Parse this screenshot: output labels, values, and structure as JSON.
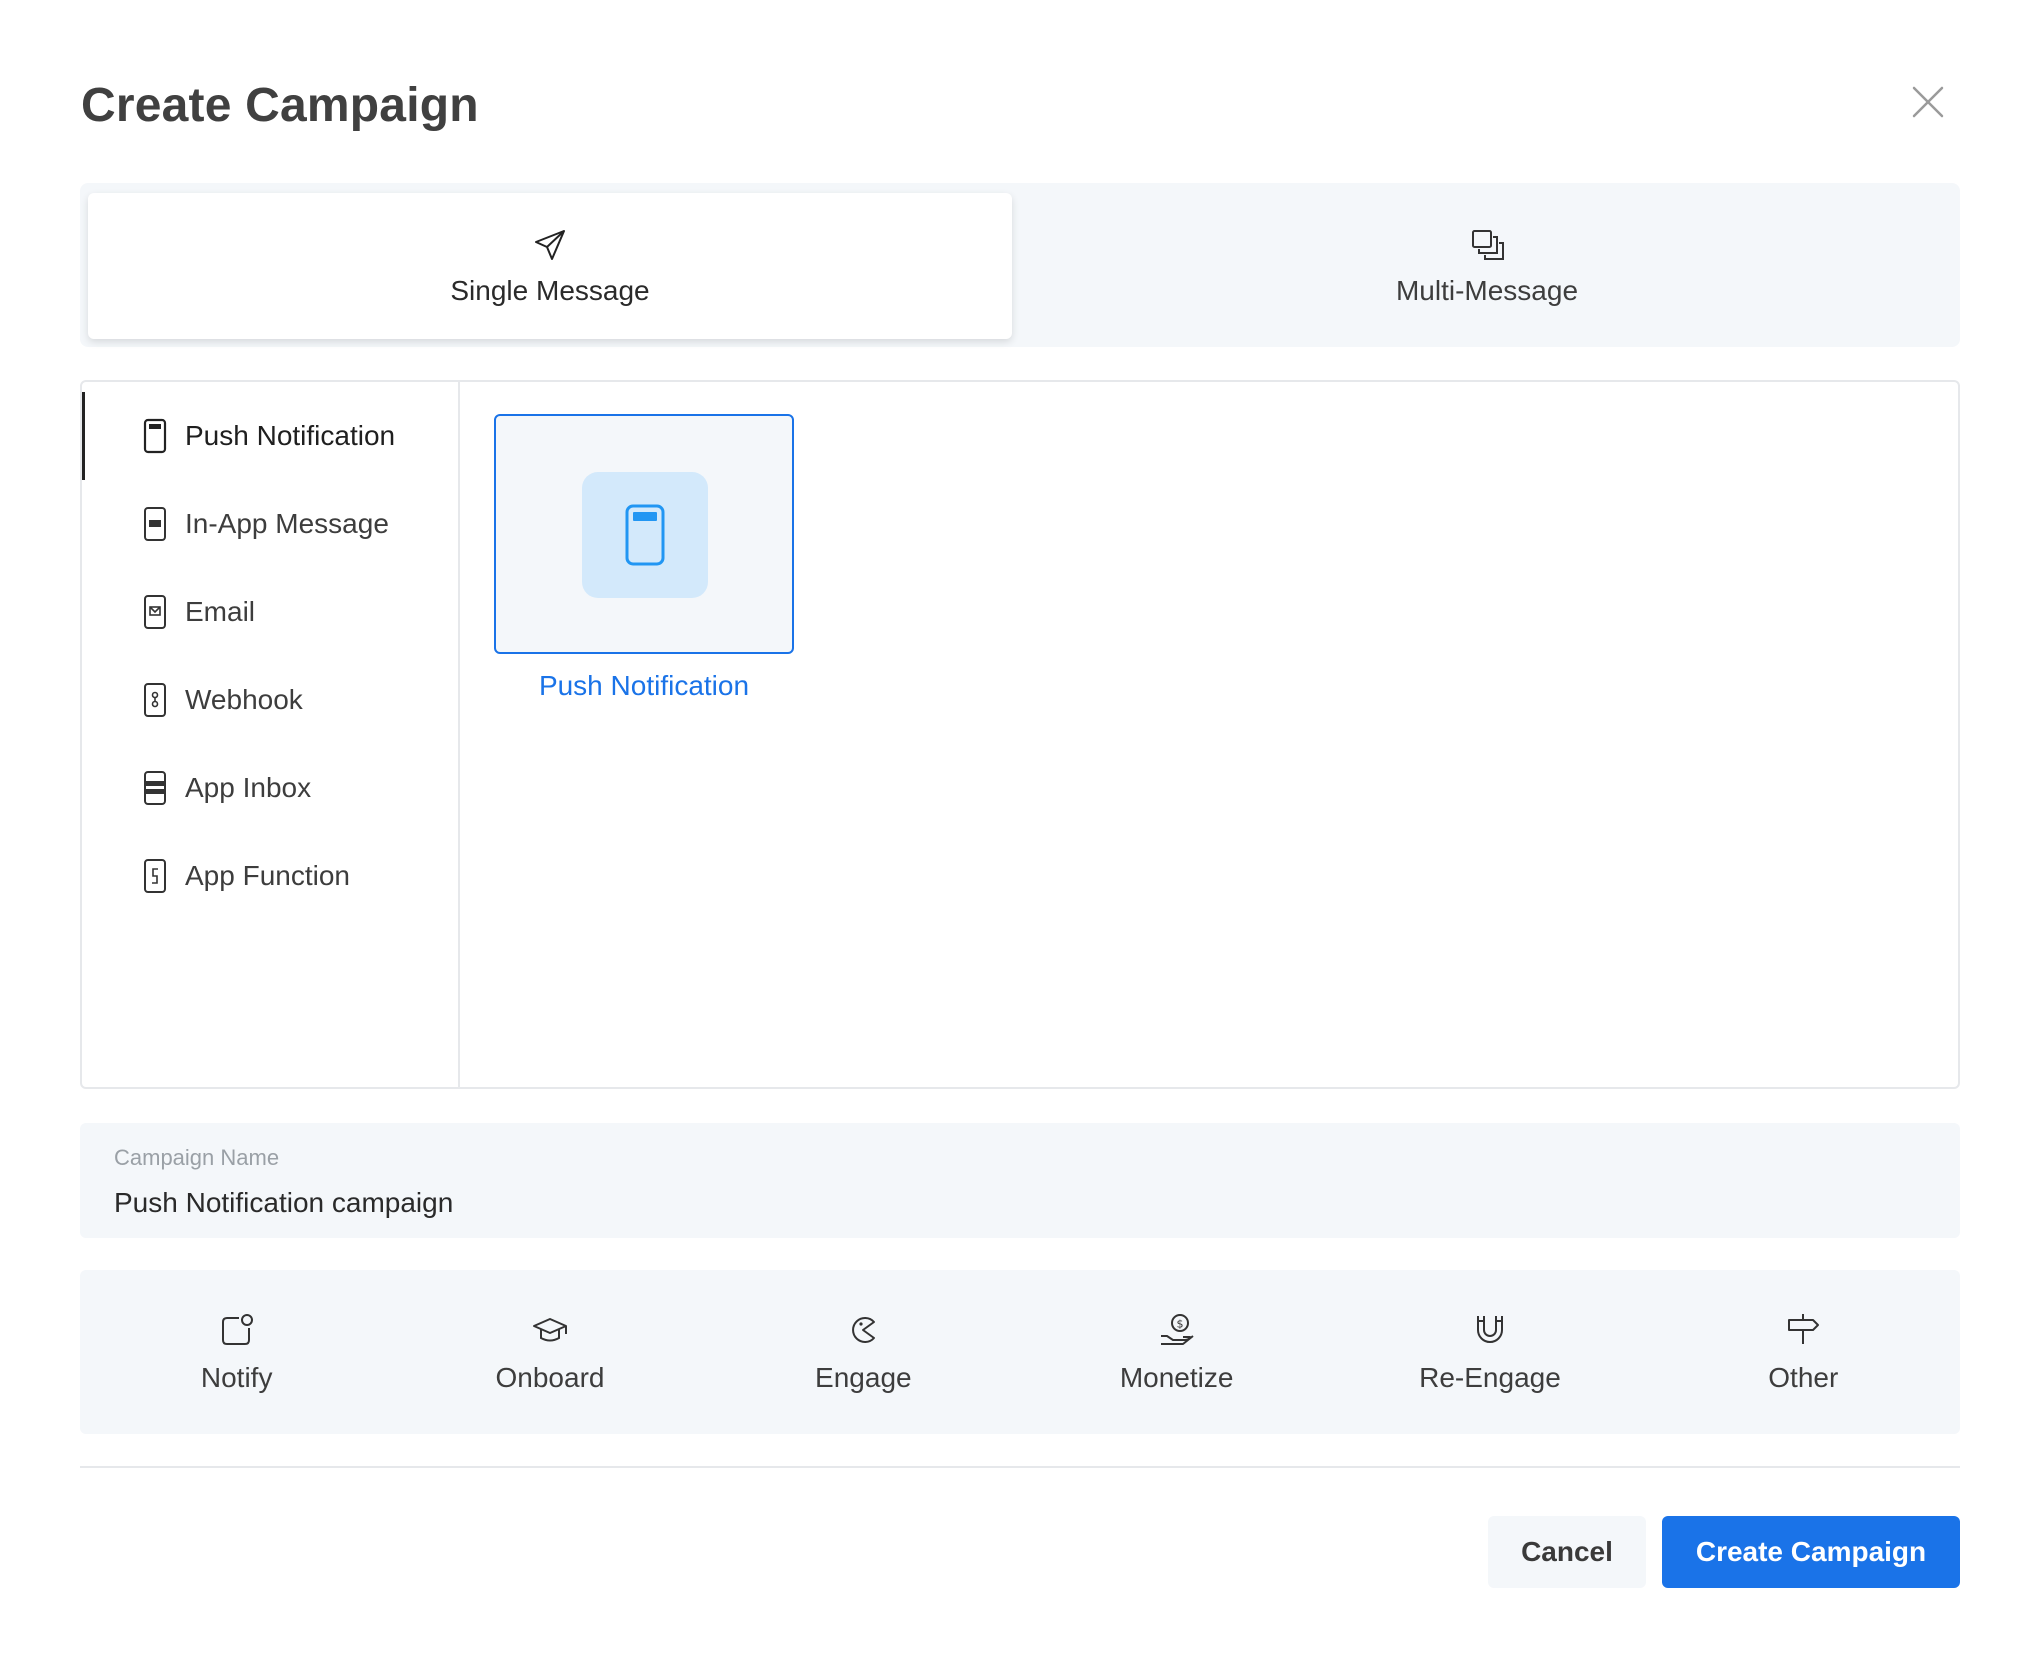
{
  "dialog": {
    "title": "Create Campaign"
  },
  "message_types": [
    {
      "label": "Single Message",
      "icon": "paper-plane-icon",
      "selected": true
    },
    {
      "label": "Multi-Message",
      "icon": "stacked-squares-icon",
      "selected": false
    }
  ],
  "channels": [
    {
      "label": "Push Notification",
      "icon": "phone-push-icon",
      "selected": true
    },
    {
      "label": "In-App Message",
      "icon": "phone-in-app-icon",
      "selected": false
    },
    {
      "label": "Email",
      "icon": "phone-email-icon",
      "selected": false
    },
    {
      "label": "Webhook",
      "icon": "phone-webhook-icon",
      "selected": false
    },
    {
      "label": "App Inbox",
      "icon": "phone-inbox-icon",
      "selected": false
    },
    {
      "label": "App Function",
      "icon": "phone-function-icon",
      "selected": false
    }
  ],
  "templates": [
    {
      "label": "Push Notification",
      "icon": "phone-push-icon",
      "selected": true
    }
  ],
  "campaign_name": {
    "label": "Campaign Name",
    "value": "Push Notification campaign"
  },
  "goals": [
    {
      "label": "Notify",
      "icon": "notification-badge-icon"
    },
    {
      "label": "Onboard",
      "icon": "graduation-cap-icon"
    },
    {
      "label": "Engage",
      "icon": "pacman-icon"
    },
    {
      "label": "Monetize",
      "icon": "hand-coin-icon"
    },
    {
      "label": "Re-Engage",
      "icon": "magnet-icon"
    },
    {
      "label": "Other",
      "icon": "signpost-icon"
    }
  ],
  "actions": {
    "cancel": "Cancel",
    "create": "Create Campaign"
  },
  "colors": {
    "accent": "#1a73e8",
    "panel_bg": "#f4f7fa",
    "icon_tile": "#d3e9fb"
  }
}
